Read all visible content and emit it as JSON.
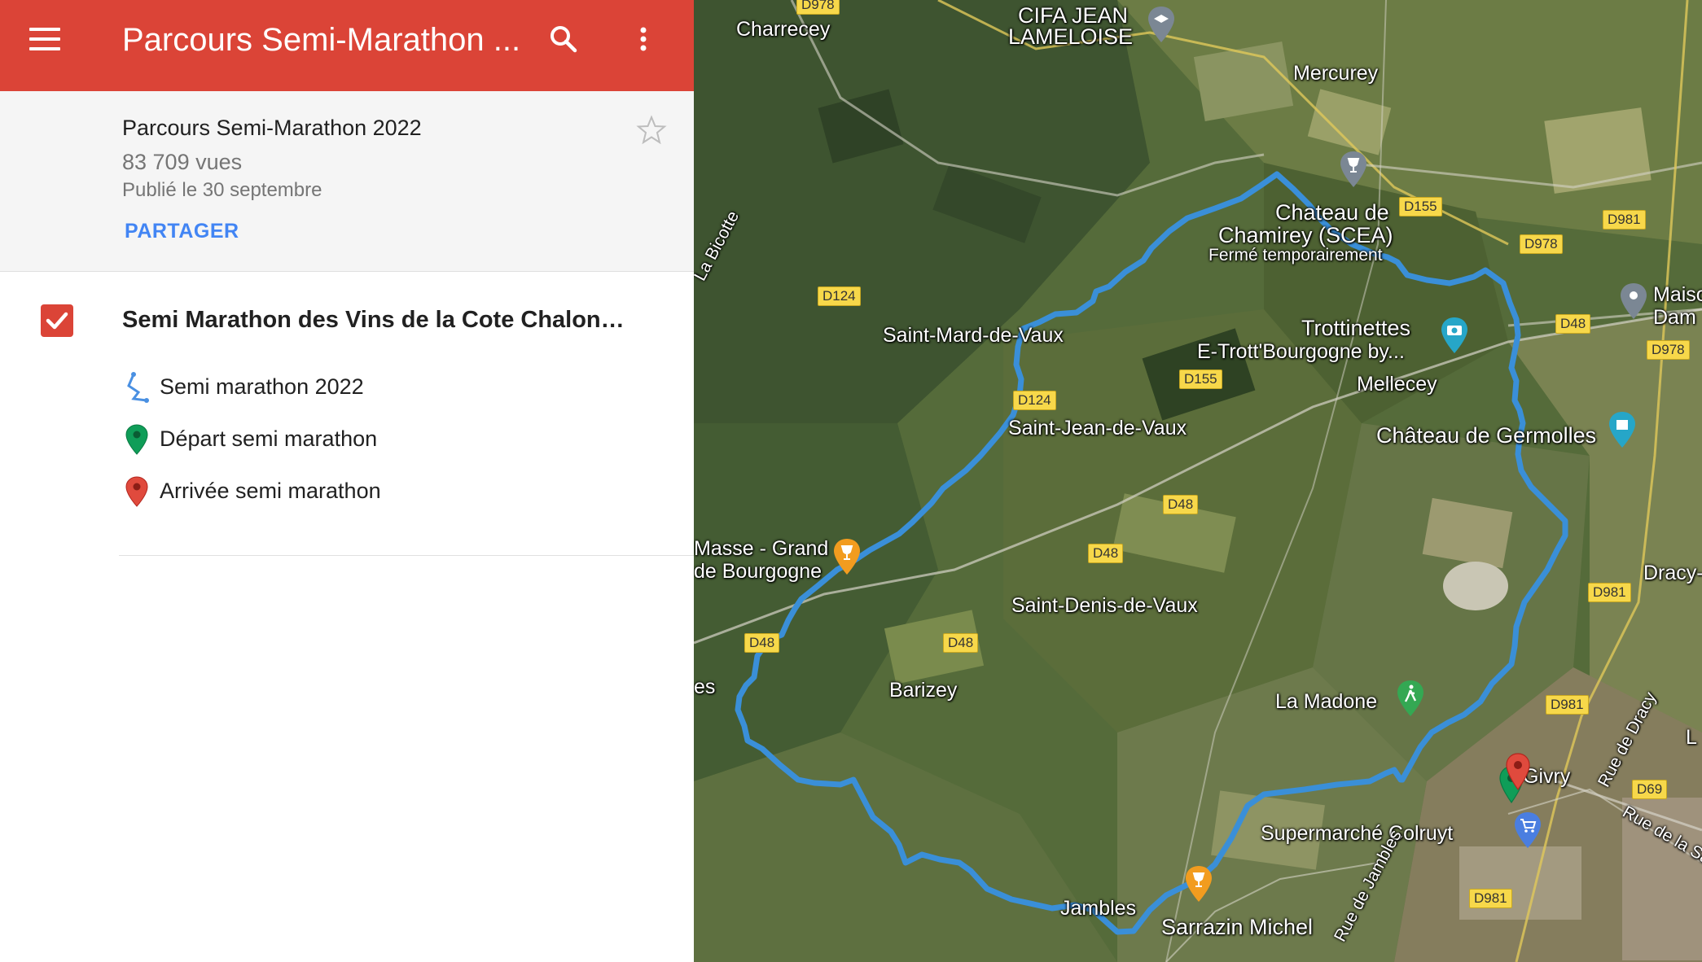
{
  "header": {
    "title": "Parcours Semi-Marathon ...",
    "bg_color": "#db4437"
  },
  "map_info": {
    "name": "Parcours Semi-Marathon 2022",
    "views": "83 709 vues",
    "published": "Publié le 30 septembre",
    "share_label": "PARTAGER"
  },
  "layer": {
    "title": "Semi Marathon des Vins de la Cote Chalon…",
    "checked": true,
    "features": [
      {
        "label": "Semi marathon 2022",
        "icon": "route-line-icon",
        "color": "#4a90e2"
      },
      {
        "label": "Départ semi marathon",
        "icon": "green-pin-icon",
        "color": "#0f9d58"
      },
      {
        "label": "Arrivée semi marathon",
        "icon": "red-pin-icon",
        "color": "#db4437"
      }
    ]
  },
  "map": {
    "route_color": "#3a8fd8",
    "places": [
      "Charrecey",
      "CIFA JEAN",
      "LAMELOISE",
      "Mercurey",
      "Chateau de",
      "Chamirey (SCEA)",
      "Fermé temporairement",
      "Saint-Mard-de-Vaux",
      "Trottinettes",
      "E-Trott'Bourgogne by...",
      "Mellecey",
      "Saint-Jean-de-Vaux",
      "Château de Germolles",
      "Maiso",
      "Dam",
      "Masse - Grand",
      "de Bourgogne",
      "Saint-Denis-de-Vaux",
      "Barizey",
      "La Madone",
      "Dracy-",
      "Supermarché Colruyt",
      "Jambles",
      "Sarrazin Michel",
      "La Bicotte",
      "Rue de Jambles",
      "Rue de Dracy",
      "Rue de la Saul",
      "Givry",
      "es",
      "L"
    ],
    "roads": [
      "D978",
      "D155",
      "D978",
      "D981",
      "D124",
      "D48",
      "D978",
      "D155",
      "D124",
      "D48",
      "D48",
      "D981",
      "D48",
      "D48",
      "D981",
      "D69",
      "D981"
    ]
  }
}
